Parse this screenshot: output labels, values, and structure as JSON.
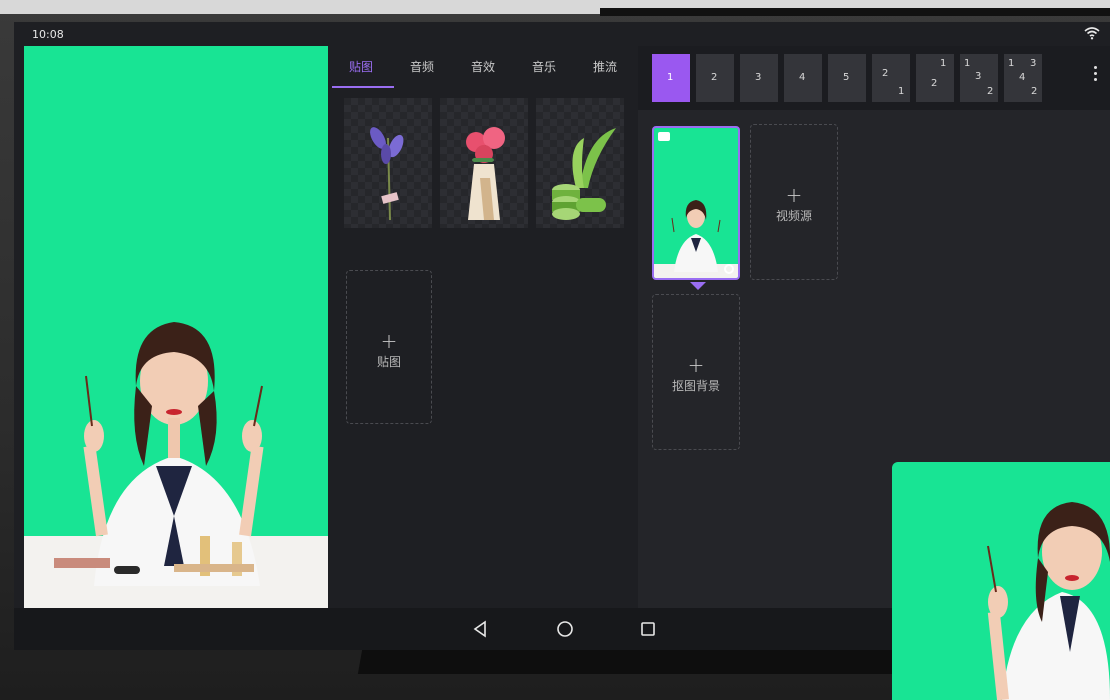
{
  "status_bar": {
    "time": "10:08"
  },
  "tabs": [
    {
      "label": "贴图",
      "active": true
    },
    {
      "label": "音频",
      "active": false
    },
    {
      "label": "音效",
      "active": false
    },
    {
      "label": "音乐",
      "active": false
    },
    {
      "label": "推流",
      "active": false
    }
  ],
  "sticker_panel": {
    "add_label": "贴图",
    "stickers": [
      "lavender-sticker",
      "rose-vase-sticker",
      "aloe-sticker"
    ]
  },
  "scenes": {
    "items": [
      {
        "label": "1",
        "active": true
      },
      {
        "label": "2",
        "active": false
      },
      {
        "label": "3",
        "active": false
      },
      {
        "label": "4",
        "active": false
      },
      {
        "label": "5",
        "active": false
      }
    ],
    "layouts": [
      {
        "nums": [
          "2",
          "1"
        ]
      },
      {
        "nums": [
          "1",
          "2"
        ]
      },
      {
        "nums": [
          "1",
          "3",
          "2"
        ]
      },
      {
        "nums": [
          "1",
          "3",
          "4",
          "2"
        ]
      }
    ]
  },
  "scene_panel": {
    "add_video_source_label": "视频源",
    "add_matting_background_label": "抠图背景"
  },
  "colors": {
    "accent": "#9a6ef2",
    "chroma_green": "#18e494",
    "background": "#1e1f23"
  }
}
